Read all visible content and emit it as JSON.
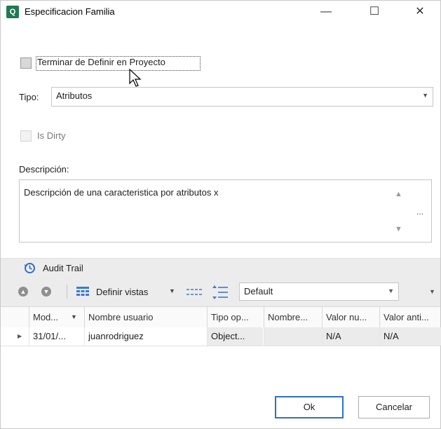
{
  "window": {
    "title": "Especificacion Familia",
    "app_icon_glyph": "Q",
    "controls": {
      "minimize": "—",
      "maximize": "☐",
      "close": "✕"
    }
  },
  "form": {
    "terminar_label": "Terminar de Definir en Proyecto",
    "tipo_label": "Tipo:",
    "tipo_value": "Atributos",
    "is_dirty_label": "Is Dirty",
    "descripcion_label": "Descripción:",
    "descripcion_value": "Descripción de una caracteristica por atributos x",
    "memo_ellipsis": "..."
  },
  "audit": {
    "title": "Audit Trail",
    "toolbar": {
      "definir_vistas_label": "Definir vistas",
      "view_value": "Default"
    },
    "columns": [
      "Mod...",
      "Nombre usuario",
      "Tipo op...",
      "Nombre...",
      "Valor nu...",
      "Valor anti..."
    ],
    "rows": [
      {
        "mod": "31/01/...",
        "usuario": "juanrodriguez",
        "tipo": "Object...",
        "nombre": "",
        "valor_nuevo": "N/A",
        "valor_anterior": "N/A"
      }
    ]
  },
  "footer": {
    "ok_label": "Ok",
    "cancel_label": "Cancelar"
  },
  "colors": {
    "accent": "#2f6fc6",
    "app_icon": "#1f7a52",
    "grid_icon": "#3a7bd5"
  }
}
